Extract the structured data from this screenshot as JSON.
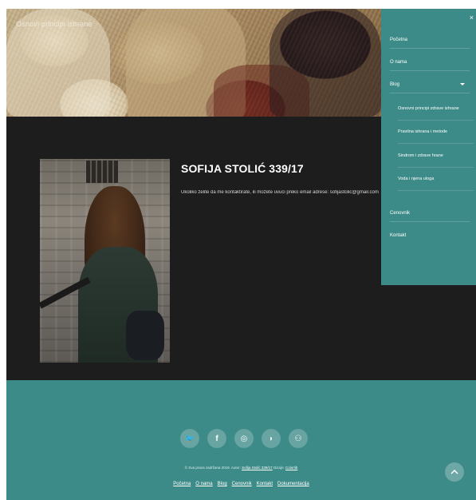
{
  "site": {
    "title": "Osnovi principi ishrane"
  },
  "student": {
    "name": "SOFIJA STOLIĆ 339/17",
    "text": "Ukoliko želite da me kontaktirate, ili možete uvući preko email adrese: sofijastolic@gmail.com"
  },
  "nav": {
    "close_glyph": "×",
    "items": [
      {
        "label": "Početna"
      },
      {
        "label": "O nama"
      },
      {
        "label": "Blog"
      },
      {
        "label": "Osnovni principi zdrave ishrane"
      },
      {
        "label": "Pravilna ishrana i metode"
      },
      {
        "label": "Sindrom i zdrave hrane"
      },
      {
        "label": "Voda i njena uloga"
      },
      {
        "label": "Cenovnik"
      },
      {
        "label": "Kontakt"
      }
    ]
  },
  "footer": {
    "social": [
      {
        "glyph": "🐦",
        "icon": "twitter-icon"
      },
      {
        "glyph": "f",
        "icon": "facebook-icon"
      },
      {
        "glyph": "◎",
        "icon": "instagram-icon"
      },
      {
        "glyph": "◗",
        "icon": "rss-icon"
      },
      {
        "glyph": "⚇",
        "icon": "sitemap-icon"
      }
    ],
    "copyright_text": "© Sva prava zadržana 2019. Autor:",
    "copyright_author": "Sofija Stolić 339/17",
    "copyright_suffix": "Dizajn:",
    "copyright_design": "Colorlib",
    "links": [
      "Početna",
      "O nama",
      "Blog",
      "Cenovnik",
      "Kontakt",
      "Dokumentacija"
    ]
  },
  "colors": {
    "teal": "#3d8b88",
    "dark": "#1d1d1d"
  }
}
